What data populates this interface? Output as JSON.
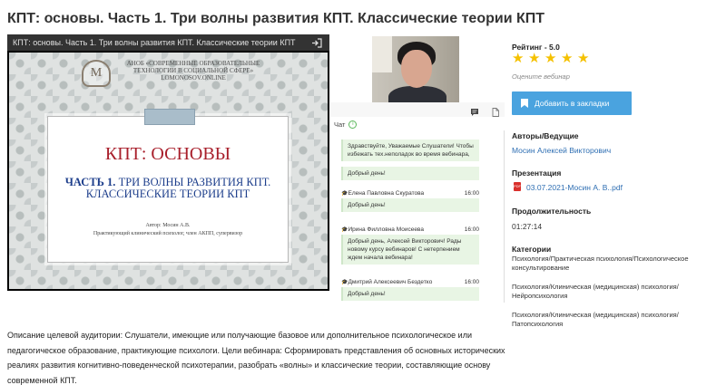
{
  "page": {
    "title": "КПТ: основы. Часть 1. Три волны развития КПТ. Классические теории КПТ"
  },
  "player": {
    "bar_title": "КПТ: основы. Часть 1. Три волны развития КПТ. Классические теории КПТ",
    "icons": {
      "exit": "exit-icon"
    }
  },
  "slide": {
    "logo_letter": "M",
    "org_lines": [
      "АНОБ «СОВРЕМЕННЫЕ ОБРАЗОВАТЕЛЬНЫЕ",
      "ТЕХНОЛОГИИ В СОЦИАЛЬНОЙ СФЕРЕ»",
      "LOMONOSOV.ONLINE"
    ],
    "main_title": "КПТ: ОСНОВЫ",
    "sub_part": "ЧАСТЬ 1.",
    "sub_line1_rest": " ТРИ ВОЛНЫ РАЗВИТИЯ КПТ.",
    "sub_line2": "КЛАССИЧЕСКИЕ ТЕОРИИ КПТ",
    "author": "Автор: Мосин А.В.",
    "author_role": "Практикующий клинический психолог, член АКПП, супервизор"
  },
  "chat": {
    "label": "Чат",
    "icons": {
      "info": "info-icon",
      "comment": "comment-icon",
      "document": "document-icon",
      "sender": "graduation-cap-icon"
    },
    "messages": [
      {
        "author": "",
        "time": "",
        "text": "Здравствуйте, Уважаемые Слушатели! Чтобы избежать тех.неполадок во время вебинара,"
      },
      {
        "author": "",
        "time": "",
        "text": "Добрый день!"
      },
      {
        "author": "Елена Павловна Скуратова",
        "time": "16:00",
        "text": "Добрый день!"
      },
      {
        "author": "Ирина Филловна Моисеева",
        "time": "16:00",
        "text": "Добрый день, Алексей Викторович! Рады новому курсу вебинаров! С нетерпением ждем начала вебинара!"
      },
      {
        "author": "Дмитрий Алексеевич Бездетко",
        "time": "16:00",
        "text": "Добрый день!"
      }
    ]
  },
  "sidebar": {
    "rating_label": "Рейтинг - 5.0",
    "rating": 5,
    "rating_max": 5,
    "rate_hint": "Оцените вебинар",
    "bookmark_button": "Добавить в закладки",
    "authors_label": "Авторы/Ведущие",
    "author_name": "Мосин Алексей Викторович",
    "presentation_label": "Презентация",
    "presentation_file": "03.07.2021-Мосин А. В..pdf",
    "duration_label": "Продолжительность",
    "duration": "01:27:14",
    "categories_label": "Категории",
    "categories": [
      "Психология/Практическая психология/Психологическое консультирование",
      "Психология/Клиническая (медицинская) психология/Нейропсихология",
      "Психология/Клиническая (медицинская) психология/Патопсихология"
    ],
    "colors": {
      "accent": "#4aa3df",
      "star": "#f5c100",
      "link": "#2f6fb3"
    }
  },
  "description": "Описание целевой аудитории: Слушатели, имеющие или получающие базовое или дополнительное психологическое или педагогическое образование, практикующие психологи. Цели вебинара: Сформировать представления об основных исторических реалиях развития когнитивно-поведенческой психотерапии, разобрать «волны» и классические теории, составляющие основу современной КПТ."
}
